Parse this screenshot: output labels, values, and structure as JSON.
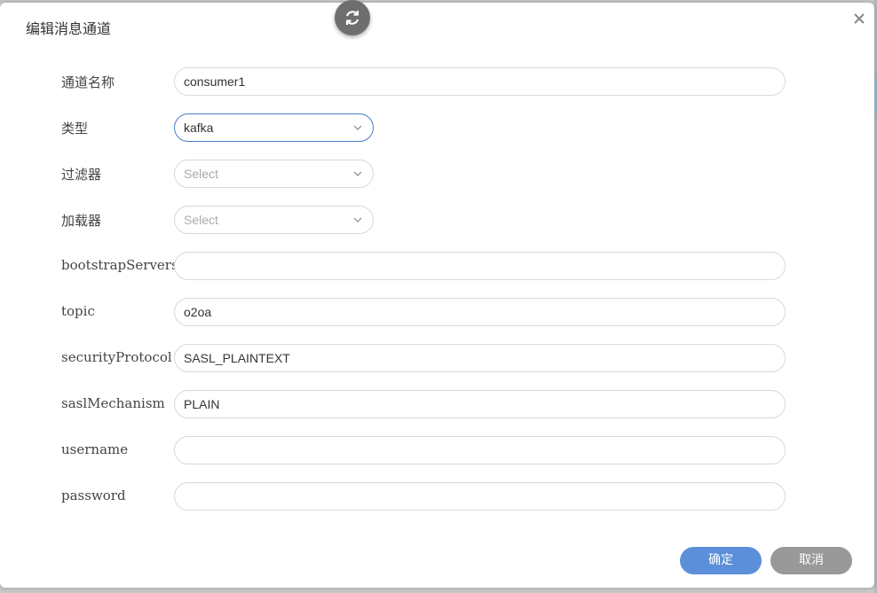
{
  "dialog": {
    "title": "编辑消息通道",
    "ok_label": "确定",
    "cancel_label": "取消"
  },
  "icons": {
    "close": "close-icon",
    "refresh": "refresh-icon",
    "chevron": "chevron-down-icon"
  },
  "colors": {
    "primary": "#5b8fd9",
    "secondary": "#999999",
    "active_border": "#4a7cc7"
  },
  "form": {
    "name": {
      "label": "通道名称",
      "value": "consumer1"
    },
    "type": {
      "label": "类型",
      "value": "kafka"
    },
    "filter": {
      "label": "过滤器",
      "placeholder": "Select"
    },
    "loader": {
      "label": "加载器",
      "placeholder": "Select"
    },
    "bootstrapServers": {
      "label": "bootstrapServers",
      "value": ""
    },
    "topic": {
      "label": "topic",
      "value": "o2oa"
    },
    "securityProtocol": {
      "label": "securityProtocol",
      "value": "SASL_PLAINTEXT"
    },
    "saslMechanism": {
      "label": "saslMechanism",
      "value": "PLAIN"
    },
    "username": {
      "label": "username",
      "value": ""
    },
    "password": {
      "label": "password",
      "value": ""
    }
  }
}
